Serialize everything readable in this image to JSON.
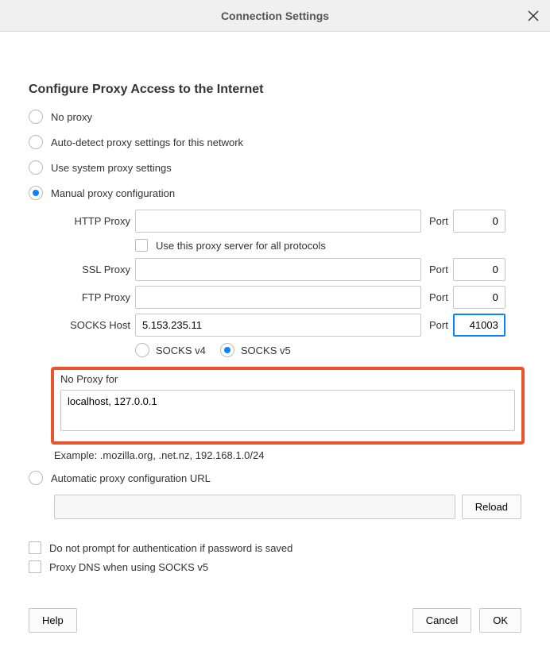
{
  "titlebar": {
    "title": "Connection Settings"
  },
  "heading": "Configure Proxy Access to the Internet",
  "options": {
    "no_proxy": "No proxy",
    "auto_detect": "Auto-detect proxy settings for this network",
    "system": "Use system proxy settings",
    "manual": "Manual proxy configuration",
    "auto_url": "Automatic proxy configuration URL"
  },
  "manual": {
    "http_label": "HTTP Proxy",
    "http_value": "",
    "port_label": "Port",
    "http_port": "0",
    "use_all_label": "Use this proxy server for all protocols",
    "ssl_label": "SSL Proxy",
    "ssl_value": "",
    "ssl_port": "0",
    "ftp_label": "FTP Proxy",
    "ftp_value": "",
    "ftp_port": "0",
    "socks_label": "SOCKS Host",
    "socks_value": "5.153.235.11",
    "socks_port": "41003",
    "socks_v4": "SOCKS v4",
    "socks_v5": "SOCKS v5"
  },
  "noproxy": {
    "label": "No Proxy for",
    "value": "localhost, 127.0.0.1",
    "example": "Example: .mozilla.org, .net.nz, 192.168.1.0/24"
  },
  "pac": {
    "value": "",
    "reload": "Reload"
  },
  "checks": {
    "no_prompt": "Do not prompt for authentication if password is saved",
    "proxy_dns": "Proxy DNS when using SOCKS v5"
  },
  "buttons": {
    "help": "Help",
    "cancel": "Cancel",
    "ok": "OK"
  }
}
